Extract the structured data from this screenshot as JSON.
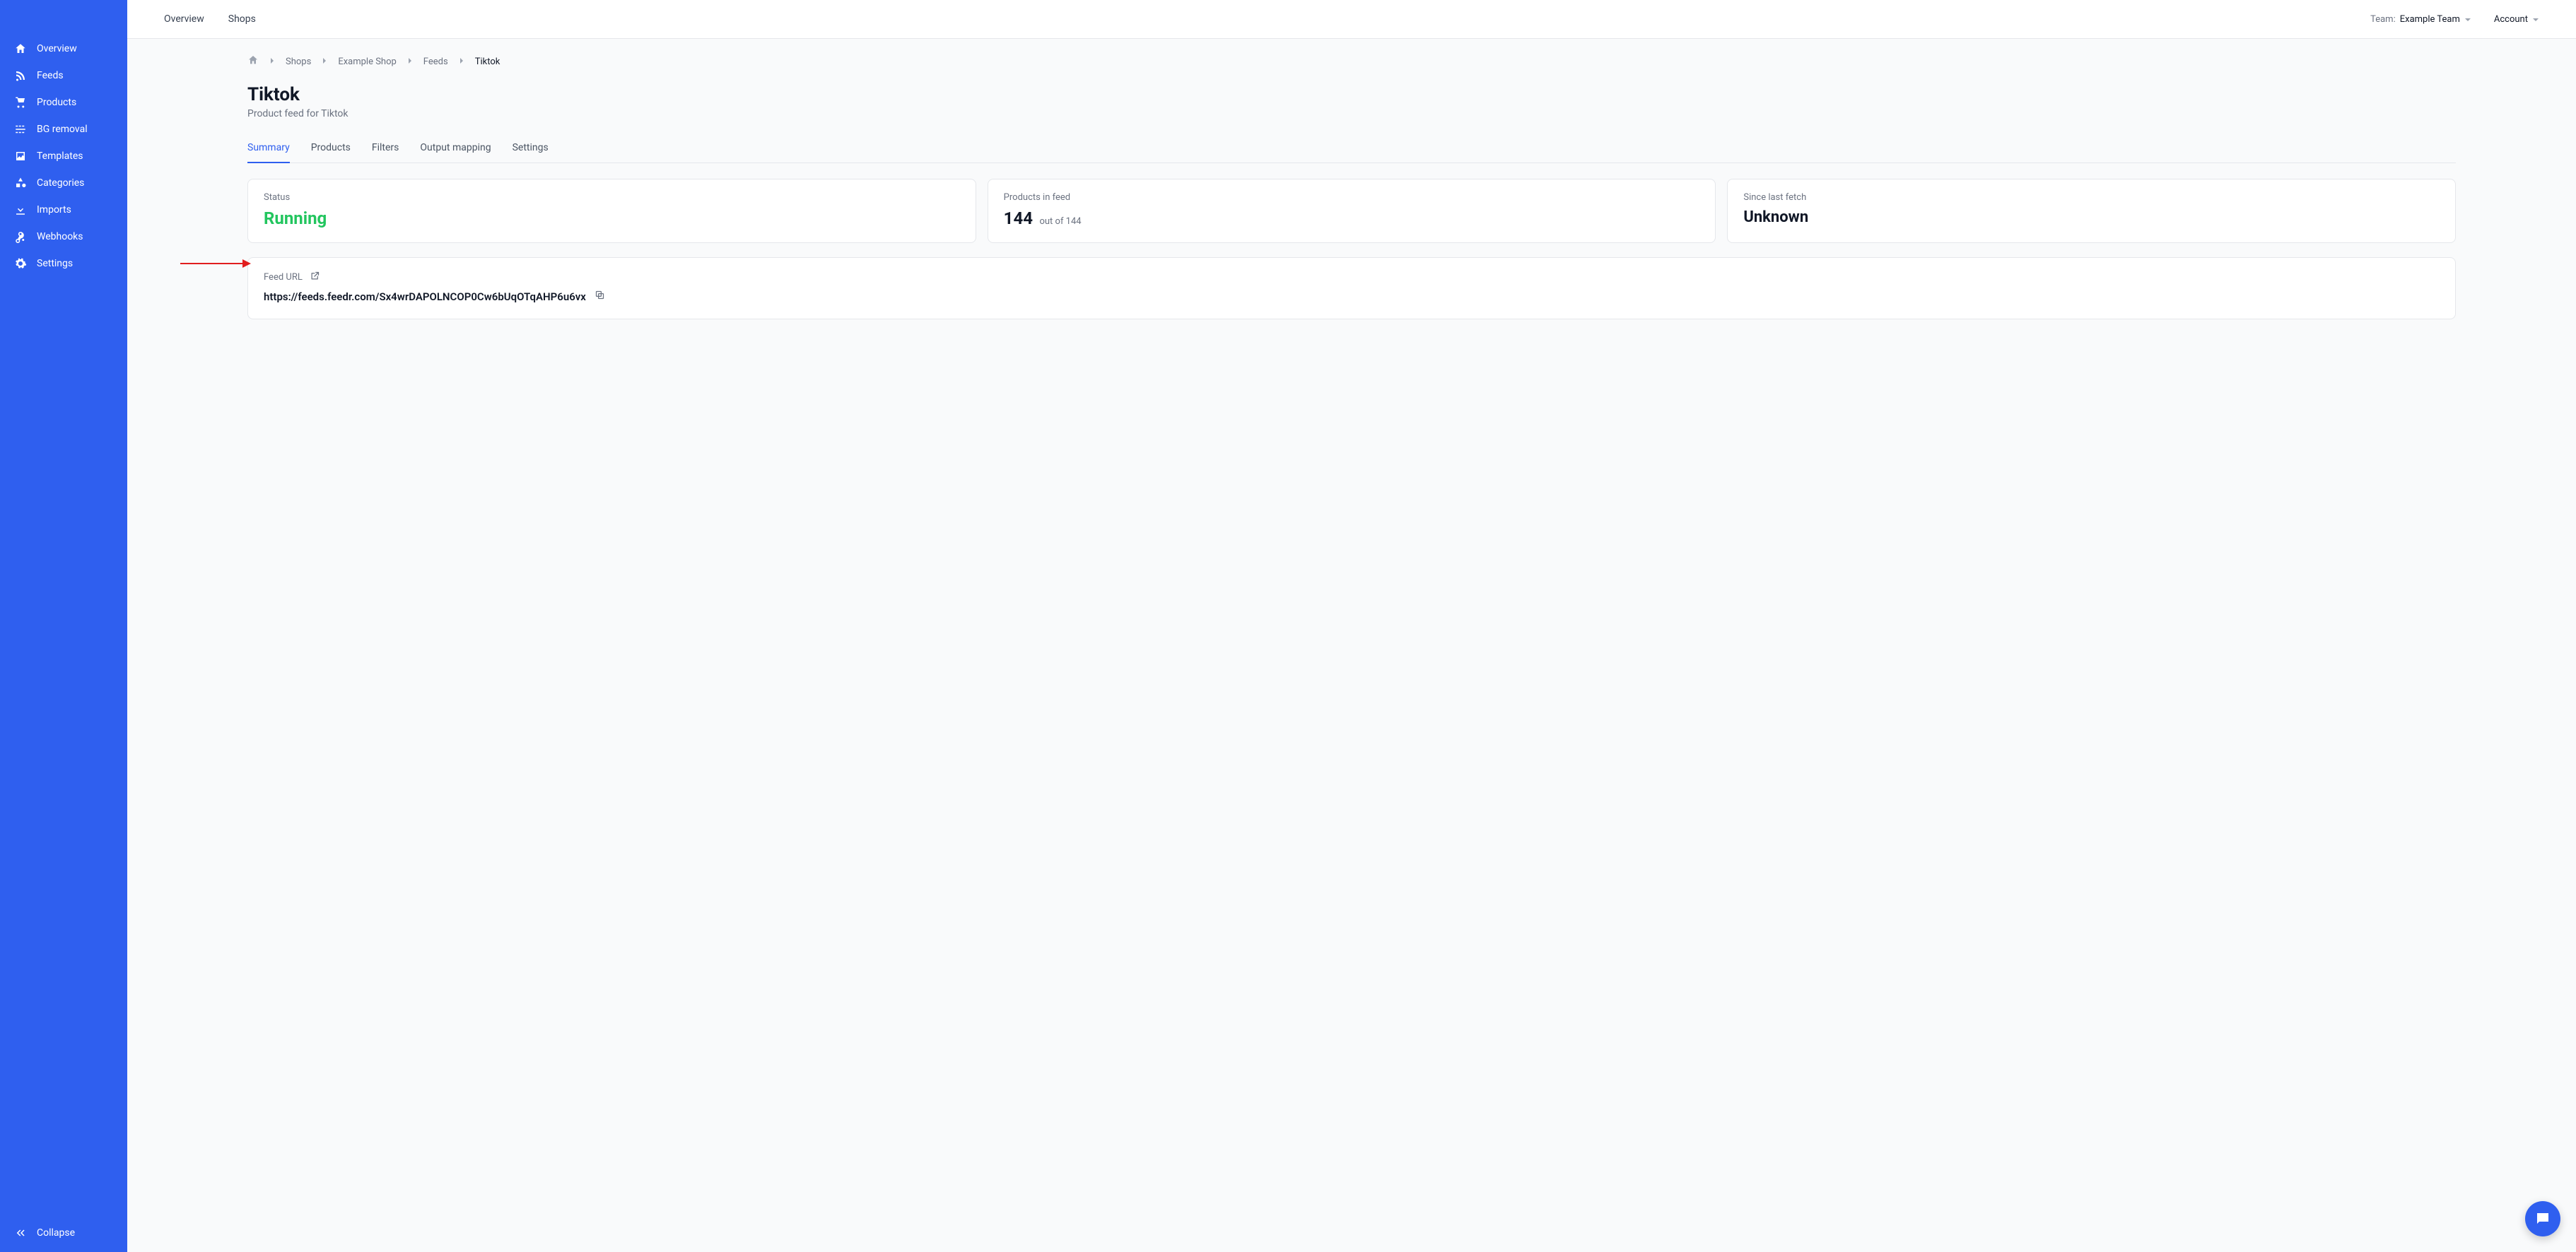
{
  "sidebar": {
    "items": [
      {
        "label": "Overview"
      },
      {
        "label": "Feeds"
      },
      {
        "label": "Products"
      },
      {
        "label": "BG removal"
      },
      {
        "label": "Templates"
      },
      {
        "label": "Categories"
      },
      {
        "label": "Imports"
      },
      {
        "label": "Webhooks"
      },
      {
        "label": "Settings"
      }
    ],
    "collapse_label": "Collapse"
  },
  "topbar": {
    "links": [
      {
        "label": "Overview"
      },
      {
        "label": "Shops"
      }
    ],
    "team_prefix": "Team:",
    "team_name": "Example Team",
    "account_label": "Account"
  },
  "breadcrumbs": {
    "items": [
      {
        "label": "Shops"
      },
      {
        "label": "Example Shop"
      },
      {
        "label": "Feeds"
      }
    ],
    "current": "Tiktok"
  },
  "page": {
    "title": "Tiktok",
    "subtitle": "Product feed for Tiktok"
  },
  "tabs": [
    {
      "label": "Summary",
      "active": true
    },
    {
      "label": "Products",
      "active": false
    },
    {
      "label": "Filters",
      "active": false
    },
    {
      "label": "Output mapping",
      "active": false
    },
    {
      "label": "Settings",
      "active": false
    }
  ],
  "cards": {
    "status": {
      "label": "Status",
      "value": "Running"
    },
    "products": {
      "label": "Products in feed",
      "count": "144",
      "sub": "out of 144"
    },
    "fetch": {
      "label": "Since last fetch",
      "value": "Unknown"
    }
  },
  "feed_url": {
    "label": "Feed URL",
    "value": "https://feeds.feedr.com/Sx4wrDAPOLNCOP0Cw6bUqOTqAHP6u6vx"
  }
}
